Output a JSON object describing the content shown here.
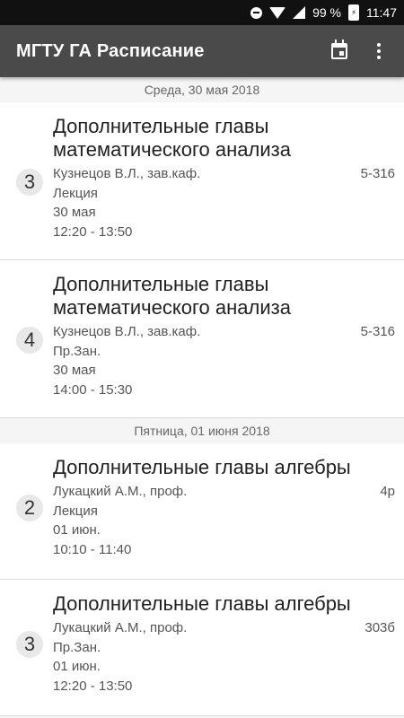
{
  "status_bar": {
    "battery_percent": "99 %",
    "time": "11:47"
  },
  "app_bar": {
    "title": "МГТУ ГА Расписание",
    "calendar_icon": "calendar-icon",
    "menu_icon": "more-vert-icon"
  },
  "days": [
    {
      "header": "Среда, 30 мая 2018",
      "lessons": [
        {
          "number": "3",
          "subject": "Дополнительные главы математического анализа",
          "teacher": "Кузнецов В.Л., зав.каф.",
          "room": "5-316",
          "type": "Лекция",
          "date": "30 мая",
          "time": "12:20 - 13:50"
        },
        {
          "number": "4",
          "subject": "Дополнительные главы математического анализа",
          "teacher": "Кузнецов В.Л., зав.каф.",
          "room": "5-316",
          "type": "Пр.Зан.",
          "date": "30 мая",
          "time": "14:00 - 15:30"
        }
      ]
    },
    {
      "header": "Пятница, 01 июня 2018",
      "lessons": [
        {
          "number": "2",
          "subject": "Дополнительные главы алгебры",
          "teacher": "Лукацкий А.М., проф.",
          "room": "4р",
          "type": "Лекция",
          "date": "01 июн.",
          "time": "10:10 - 11:40"
        },
        {
          "number": "3",
          "subject": "Дополнительные главы алгебры",
          "teacher": "Лукацкий А.М., проф.",
          "room": "303б",
          "type": "Пр.Зан.",
          "date": "01 июн.",
          "time": "12:20 - 13:50"
        }
      ]
    }
  ]
}
